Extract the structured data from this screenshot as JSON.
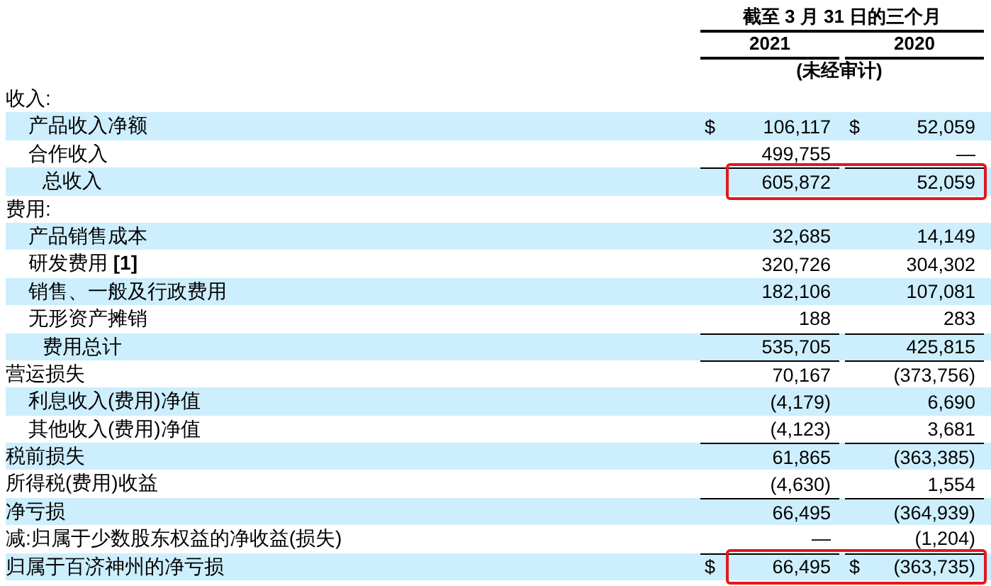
{
  "header": {
    "period": "截至 3 月 31 日的三个月",
    "years": [
      "2021",
      "2020"
    ],
    "note": "(未经审计)"
  },
  "rows": [
    {
      "kind": "heading",
      "label": "收入:",
      "shaded": false
    },
    {
      "kind": "line",
      "label": "产品收入净额",
      "shaded": true,
      "rule_above": false,
      "highlighted": false,
      "values": [
        {
          "currency": "$",
          "amount": "106,117"
        },
        {
          "currency": "$",
          "amount": "52,059"
        }
      ]
    },
    {
      "kind": "line",
      "label": "合作收入",
      "shaded": false,
      "rule_above": false,
      "highlighted": false,
      "values": [
        {
          "amount": "499,755"
        },
        {
          "amount": "—"
        }
      ]
    },
    {
      "kind": "subtotal",
      "label": "总收入",
      "shaded": true,
      "rule_above": true,
      "highlighted": true,
      "values": [
        {
          "amount": "605,872"
        },
        {
          "amount": "52,059"
        }
      ]
    },
    {
      "kind": "heading",
      "label": "费用:",
      "shaded": false
    },
    {
      "kind": "line",
      "label": "产品销售成本",
      "shaded": true,
      "rule_above": false,
      "highlighted": false,
      "values": [
        {
          "amount": "32,685"
        },
        {
          "amount": "14,149"
        }
      ]
    },
    {
      "kind": "line",
      "label": "研发费用 **[1]**",
      "shaded": false,
      "rule_above": false,
      "highlighted": false,
      "values": [
        {
          "amount": "320,726"
        },
        {
          "amount": "304,302"
        }
      ]
    },
    {
      "kind": "line",
      "label": "销售、一般及行政费用",
      "shaded": true,
      "rule_above": false,
      "highlighted": false,
      "values": [
        {
          "amount": "182,106"
        },
        {
          "amount": "107,081"
        }
      ]
    },
    {
      "kind": "line",
      "label": "无形资产摊销",
      "shaded": false,
      "rule_above": false,
      "highlighted": false,
      "values": [
        {
          "amount": "188"
        },
        {
          "amount": "283"
        }
      ]
    },
    {
      "kind": "subtotal",
      "label": "费用总计",
      "shaded": true,
      "rule_above": true,
      "highlighted": false,
      "values": [
        {
          "amount": "535,705"
        },
        {
          "amount": "425,815"
        }
      ]
    },
    {
      "kind": "total",
      "label": "营运损失",
      "shaded": false,
      "rule_above": true,
      "highlighted": false,
      "values": [
        {
          "amount": "70,167"
        },
        {
          "amount": "(373,756)"
        }
      ]
    },
    {
      "kind": "line",
      "label": "利息收入(费用)净值",
      "shaded": true,
      "rule_above": false,
      "highlighted": false,
      "values": [
        {
          "amount": "(4,179)"
        },
        {
          "amount": "6,690"
        }
      ]
    },
    {
      "kind": "line",
      "label": "其他收入(费用)净值",
      "shaded": false,
      "rule_above": false,
      "highlighted": false,
      "values": [
        {
          "amount": "(4,123)"
        },
        {
          "amount": "3,681"
        }
      ]
    },
    {
      "kind": "total",
      "label": "税前损失",
      "shaded": true,
      "rule_above": true,
      "highlighted": false,
      "values": [
        {
          "amount": "61,865"
        },
        {
          "amount": "(363,385)"
        }
      ]
    },
    {
      "kind": "total",
      "label": "所得税(费用)收益",
      "shaded": false,
      "rule_above": false,
      "highlighted": false,
      "values": [
        {
          "amount": "(4,630)"
        },
        {
          "amount": "1,554"
        }
      ]
    },
    {
      "kind": "total",
      "label": "净亏损",
      "shaded": true,
      "rule_above": true,
      "highlighted": false,
      "values": [
        {
          "amount": "66,495"
        },
        {
          "amount": "(364,939)"
        }
      ]
    },
    {
      "kind": "total",
      "label": "减:归属于少数股东权益的净收益(损失)",
      "shaded": false,
      "rule_above": false,
      "highlighted": false,
      "values": [
        {
          "amount": "—"
        },
        {
          "amount": "(1,204)"
        }
      ]
    },
    {
      "kind": "total",
      "label": "归属于百济神州的净亏损",
      "shaded": true,
      "rule_above": true,
      "highlighted": true,
      "values": [
        {
          "currency": "$",
          "amount": "66,495"
        },
        {
          "currency": "$",
          "amount": "(363,735)"
        }
      ]
    }
  ]
}
